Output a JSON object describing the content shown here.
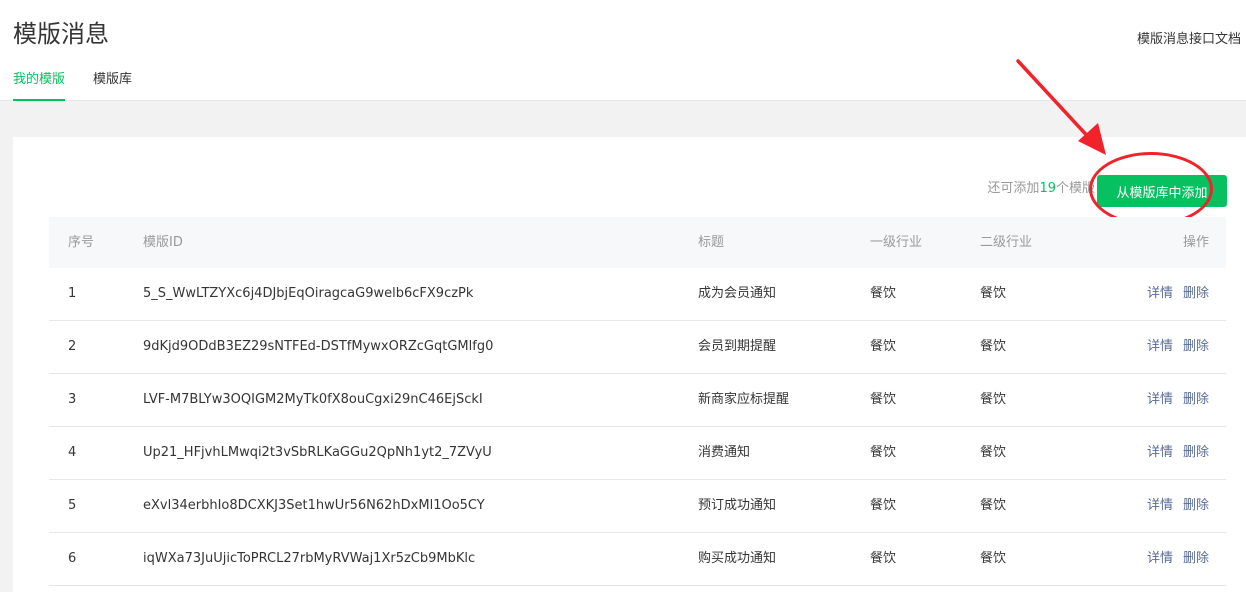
{
  "header": {
    "title": "模版消息",
    "doc_link": "模版消息接口文档",
    "tabs": [
      {
        "label": "我的模版",
        "active": true
      },
      {
        "label": "模版库",
        "active": false
      }
    ]
  },
  "toolbar": {
    "quota_prefix": "还可添加",
    "quota_count": "19",
    "quota_suffix": "个模版",
    "add_button": "从模版库中添加"
  },
  "table": {
    "columns": [
      "序号",
      "模版ID",
      "标题",
      "一级行业",
      "二级行业",
      "操作"
    ],
    "rows": [
      {
        "no": "1",
        "id": "5_S_WwLTZYXc6j4DJbjEqOiragcaG9welb6cFX9czPk",
        "title": "成为会员通知",
        "ind1": "餐饮",
        "ind2": "餐饮"
      },
      {
        "no": "2",
        "id": "9dKjd9ODdB3EZ29sNTFEd-DSTfMywxORZcGqtGMlfg0",
        "title": "会员到期提醒",
        "ind1": "餐饮",
        "ind2": "餐饮"
      },
      {
        "no": "3",
        "id": "LVF-M7BLYw3OQIGM2MyTk0fX8ouCgxi29nC46EjSckI",
        "title": "新商家应标提醒",
        "ind1": "餐饮",
        "ind2": "餐饮"
      },
      {
        "no": "4",
        "id": "Up21_HFjvhLMwqi2t3vSbRLKaGGu2QpNh1yt2_7ZVyU",
        "title": "消费通知",
        "ind1": "餐饮",
        "ind2": "餐饮"
      },
      {
        "no": "5",
        "id": "eXvl34erbhIo8DCXKJ3Set1hwUr56N62hDxMl1Oo5CY",
        "title": "预订成功通知",
        "ind1": "餐饮",
        "ind2": "餐饮"
      },
      {
        "no": "6",
        "id": "iqWXa73JuUjicToPRCL27rbMyRVWaj1Xr5zCb9MbKlc",
        "title": "购买成功通知",
        "ind1": "餐饮",
        "ind2": "餐饮"
      }
    ],
    "op_detail": "详情",
    "op_delete": "删除"
  },
  "colors": {
    "accent": "#07c160",
    "link": "#576b95",
    "annotation": "#f0232a"
  }
}
